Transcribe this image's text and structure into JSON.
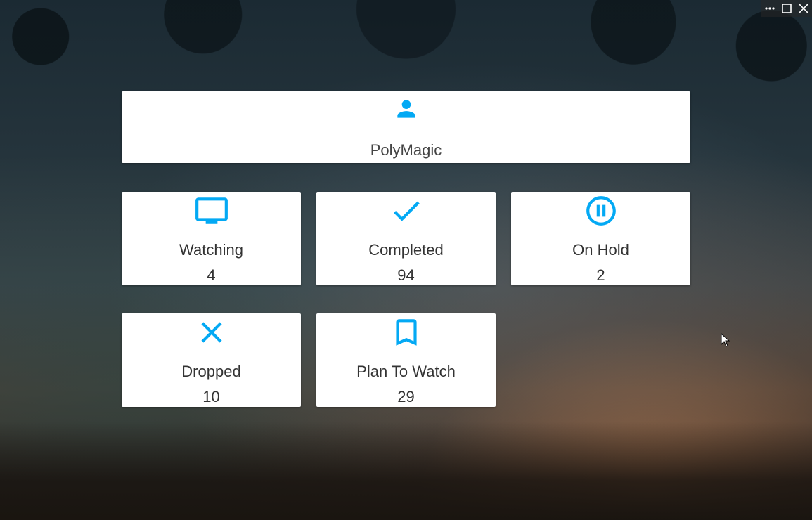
{
  "window": {
    "controls": [
      {
        "icon": "more-icon"
      },
      {
        "icon": "maximize-icon"
      },
      {
        "icon": "close-icon"
      }
    ]
  },
  "profile": {
    "icon": "person-icon",
    "username": "PolyMagic"
  },
  "accent_color": "#03A9F4",
  "stats": [
    {
      "label": "Watching",
      "count": "4",
      "icon": "tv-icon"
    },
    {
      "label": "Completed",
      "count": "94",
      "icon": "check-icon"
    },
    {
      "label": "On Hold",
      "count": "2",
      "icon": "pause-circle-icon"
    },
    {
      "label": "Dropped",
      "count": "10",
      "icon": "close-x-icon"
    },
    {
      "label": "Plan To Watch",
      "count": "29",
      "icon": "bookmark-icon"
    }
  ]
}
